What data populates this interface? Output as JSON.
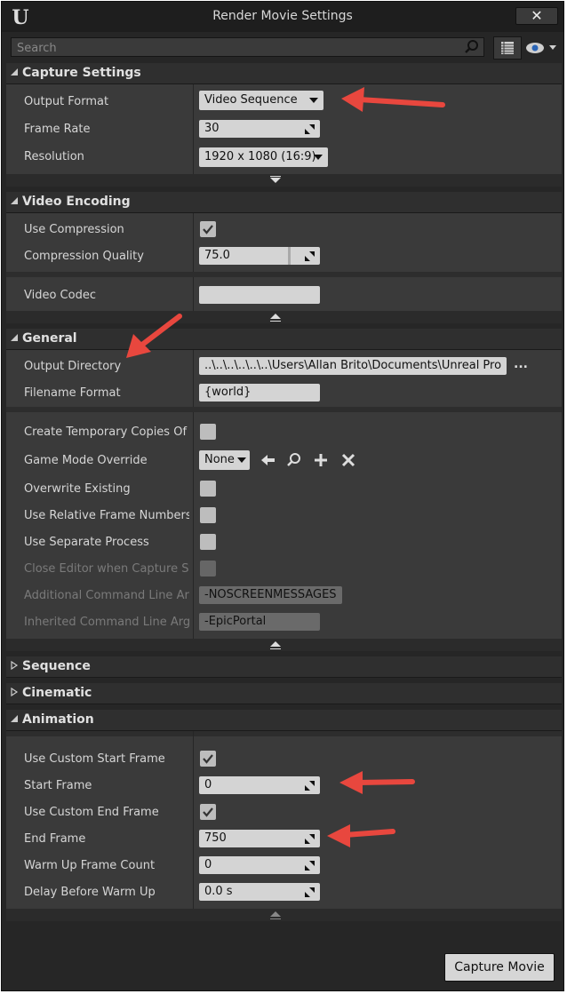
{
  "window": {
    "title": "Render Movie Settings",
    "close_label": "✕"
  },
  "search": {
    "placeholder": "Search"
  },
  "sections": {
    "capture": {
      "title": "Capture Settings",
      "output_format_label": "Output Format",
      "output_format_value": "Video Sequence",
      "frame_rate_label": "Frame Rate",
      "frame_rate_value": "30",
      "resolution_label": "Resolution",
      "resolution_value": "1920 x 1080 (16:9)"
    },
    "video": {
      "title": "Video Encoding",
      "use_compression_label": "Use Compression",
      "use_compression_checked": true,
      "compression_quality_label": "Compression Quality",
      "compression_quality_value": "75.0",
      "video_codec_label": "Video Codec",
      "video_codec_value": ""
    },
    "general": {
      "title": "General",
      "output_directory_label": "Output Directory",
      "output_directory_value": "..\\..\\..\\..\\..\\..\\Users\\Allan Brito\\Documents\\Unreal Pro",
      "browse_label": "...",
      "filename_format_label": "Filename Format",
      "filename_format_value": "{world}",
      "temp_copies_label": "Create Temporary Copies Of L",
      "game_mode_label": "Game Mode Override",
      "game_mode_value": "None",
      "overwrite_label": "Overwrite Existing",
      "relative_frames_label": "Use Relative Frame Numbers",
      "separate_process_label": "Use Separate Process",
      "close_editor_label": "Close Editor when Capture Sta",
      "additional_cmd_label": "Additional Command Line Argu",
      "additional_cmd_value": "-NOSCREENMESSAGES",
      "inherited_cmd_label": "Inherited Command Line Argu",
      "inherited_cmd_value": "-EpicPortal"
    },
    "sequence": {
      "title": "Sequence"
    },
    "cinematic": {
      "title": "Cinematic"
    },
    "animation": {
      "title": "Animation",
      "use_custom_start_label": "Use Custom Start Frame",
      "start_frame_label": "Start Frame",
      "start_frame_value": "0",
      "use_custom_end_label": "Use Custom End Frame",
      "end_frame_label": "End Frame",
      "end_frame_value": "750",
      "warmup_count_label": "Warm Up Frame Count",
      "warmup_count_value": "0",
      "delay_label": "Delay Before Warm Up",
      "delay_value": "0.0 s"
    }
  },
  "footer": {
    "capture_button": "Capture Movie"
  },
  "colors": {
    "annotation_arrow": "#e8473e",
    "panel_bg": "#3a3a3a",
    "header_bg": "#2f2f2f"
  }
}
